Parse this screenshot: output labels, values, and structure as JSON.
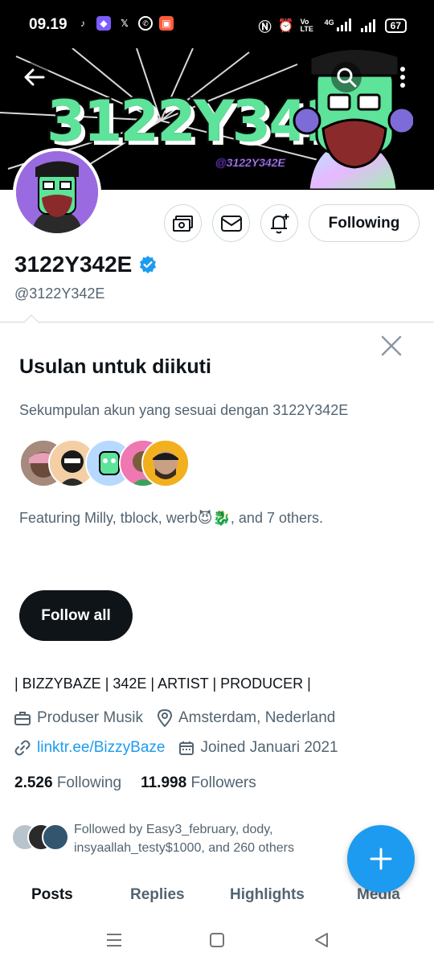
{
  "status_bar": {
    "time": "09.19",
    "battery": "67",
    "network": "4G",
    "volte": "Vo LTE",
    "apps": [
      "tiktok-icon",
      "app-icon",
      "x-icon",
      "whatsapp-icon",
      "shop-icon"
    ]
  },
  "banner": {
    "logo_text": "3122Y342E",
    "handle_text": "@3122Y342E"
  },
  "profile": {
    "display_name": "3122Y342E",
    "handle": "@3122Y342E",
    "verified": true,
    "following_button": "Following"
  },
  "suggestions": {
    "title": "Usulan untuk diikuti",
    "subtitle": "Sekumpulan akun yang sesuai dengan 3122Y342E",
    "featuring": "Featuring Milly, tblock, werb😈🐉, and 7 others.",
    "follow_all": "Follow all"
  },
  "bio": {
    "text": "| BIZZYBAZE | 342E | ARTIST | PRODUCER |",
    "profession": "Produser Musik",
    "location": "Amsterdam, Nederland",
    "link": "linktr.ee/BizzyBaze",
    "joined": "Joined Januari 2021"
  },
  "counts": {
    "following_value": "2.526",
    "following_label": "Following",
    "followers_value": "11.998",
    "followers_label": "Followers"
  },
  "followed_by": {
    "text": "Followed by Easy3_february, dody, insyaallah_testy$1000, and 260 others"
  },
  "tabs": [
    {
      "label": "Posts"
    },
    {
      "label": "Replies"
    },
    {
      "label": "Highlights"
    },
    {
      "label": "Media"
    }
  ],
  "colors": {
    "accent": "#1d9bf0",
    "text_primary": "#0f1419",
    "text_secondary": "#536471",
    "banner_logo": "#5de39a"
  }
}
